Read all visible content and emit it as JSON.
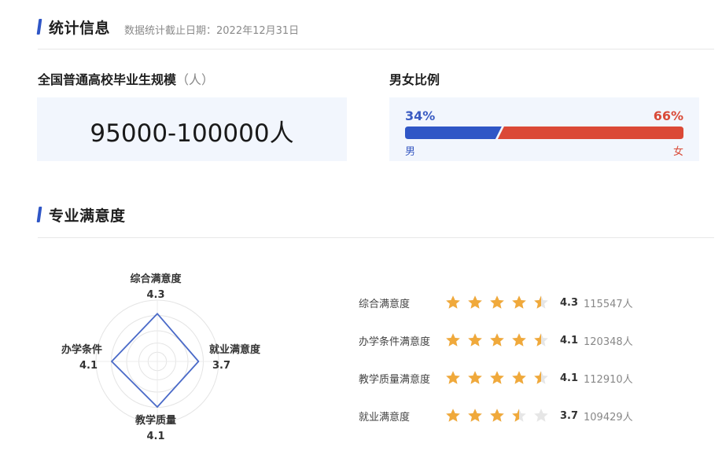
{
  "statistics": {
    "title": "统计信息",
    "cutoff_label": "数据统计截止日期：2022年12月31日",
    "graduates": {
      "label": "全国普通高校毕业生规模",
      "unit": "（人）",
      "value": "95000-100000人"
    },
    "gender": {
      "label": "男女比例",
      "male_percent_text": "34%",
      "female_percent_text": "66%",
      "male_fraction": 0.34,
      "male_label": "男",
      "female_label": "女",
      "male_color": "#2f56c6",
      "female_color": "#db4936"
    }
  },
  "satisfaction": {
    "title": "专业满意度",
    "radar": {
      "max": 5,
      "axes": [
        {
          "name": "综合满意度",
          "value": 4.3,
          "value_text": "4.3"
        },
        {
          "name": "就业满意度",
          "value": 3.7,
          "value_text": "3.7"
        },
        {
          "name": "教学质量",
          "value": 4.1,
          "value_text": "4.1"
        },
        {
          "name": "办学条件",
          "value": 4.1,
          "value_text": "4.1"
        }
      ],
      "line_color": "#4a6ac8"
    },
    "ratings": [
      {
        "label": "综合满意度",
        "stars": 4.5,
        "score": "4.3",
        "count": "115547人"
      },
      {
        "label": "办学条件满意度",
        "stars": 4.5,
        "score": "4.1",
        "count": "120348人"
      },
      {
        "label": "教学质量满意度",
        "stars": 4.5,
        "score": "4.1",
        "count": "112910人"
      },
      {
        "label": "就业满意度",
        "stars": 3.5,
        "score": "3.7",
        "count": "109429人"
      }
    ],
    "star_color": "#f0a93b",
    "star_empty_color": "#e6e6e6"
  }
}
